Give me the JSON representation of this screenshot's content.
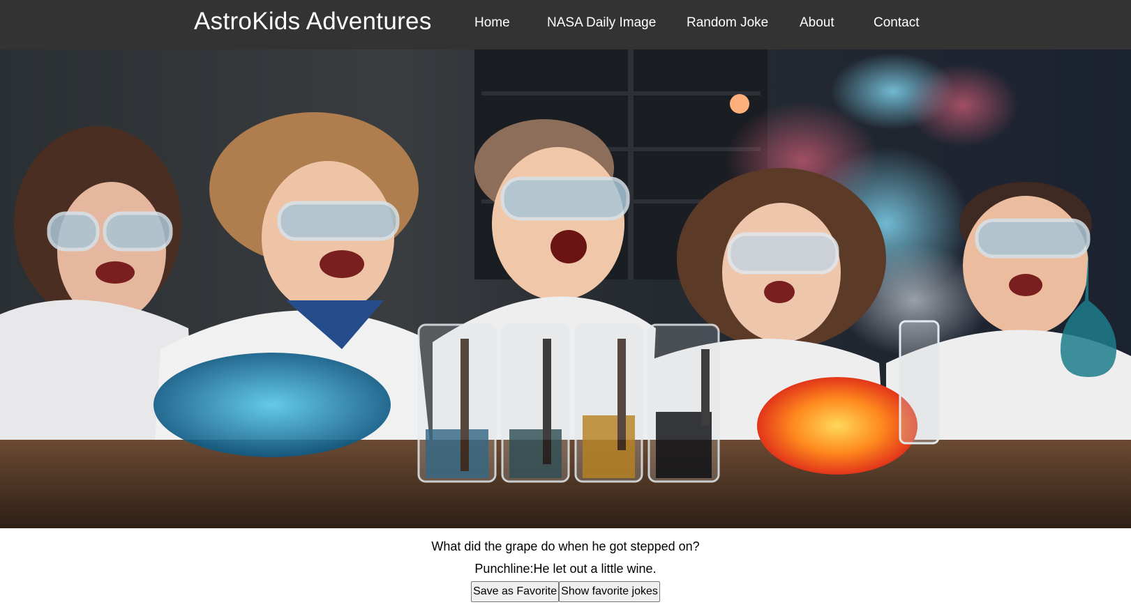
{
  "header": {
    "brand": "AstroKids Adventures",
    "nav": [
      "Home",
      "NASA Daily Image",
      "Random Joke",
      "About",
      "Contact"
    ]
  },
  "hero": {
    "alt": "Children in lab coats and goggles doing colorful science experiments"
  },
  "joke": {
    "setup": "What did the grape do when he got stepped on?",
    "punchline": "Punchline:He let out a little wine."
  },
  "buttons": {
    "save_favorite": "Save as Favorite",
    "show_favorites": "Show favorite jokes"
  },
  "colors": {
    "navbar_bg": "#333333",
    "nav_text": "#ffffff",
    "page_bg": "#ffffff"
  }
}
